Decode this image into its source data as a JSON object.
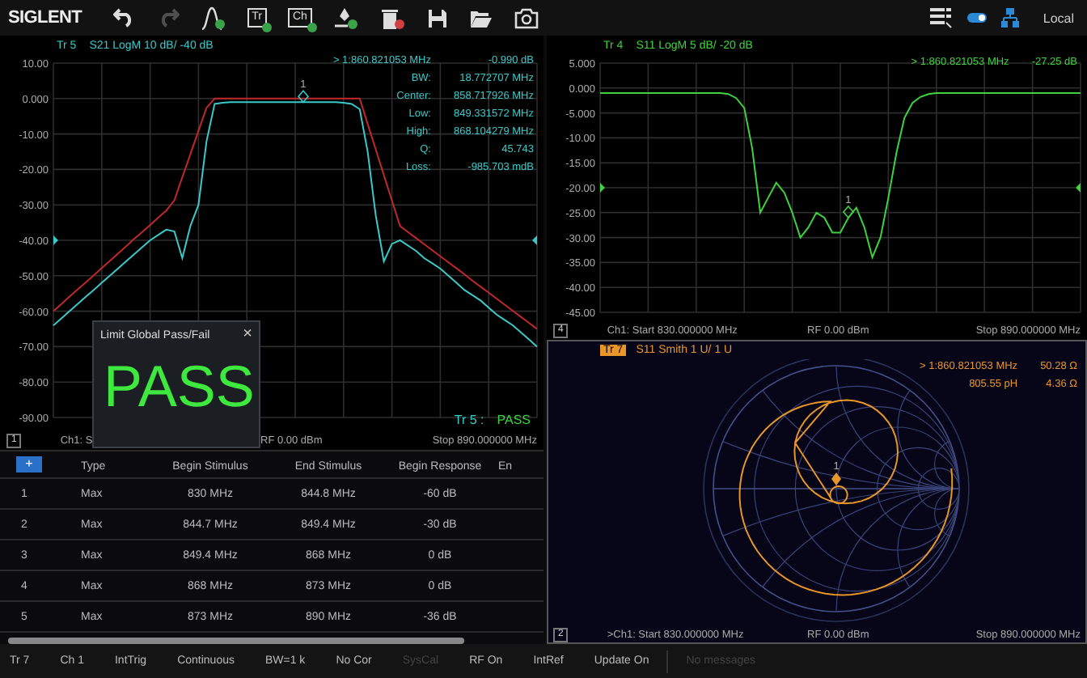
{
  "toolbar": {
    "logo": "SIGLENT",
    "tools": [
      {
        "kind": "undo",
        "disabled": false
      },
      {
        "kind": "redo",
        "disabled": true
      },
      {
        "kind": "filter",
        "disabled": false
      },
      {
        "kind": "trace",
        "label": "Tr",
        "disabled": false
      },
      {
        "kind": "channel",
        "label": "Ch",
        "disabled": false
      },
      {
        "kind": "marker",
        "disabled": false
      },
      {
        "kind": "delete",
        "disabled": false
      },
      {
        "kind": "save",
        "disabled": false
      },
      {
        "kind": "open",
        "disabled": false
      },
      {
        "kind": "camera",
        "disabled": false
      }
    ],
    "status_icons": [
      {
        "kind": "list"
      },
      {
        "kind": "toggle"
      },
      {
        "kind": "network"
      }
    ],
    "mode": "Local"
  },
  "panels": [
    {
      "kind": "logmag",
      "number": "1",
      "trace": "Tr 5",
      "selected": false,
      "header": "S21 LogM 10 dB/ -40 dB",
      "color": "#3cc8c8",
      "marker_label": "1",
      "readouts": [
        {
          "label": "> 1:860.821053 MHz",
          "value": "-0.990 dB"
        },
        {
          "label": "BW:",
          "value": "18.772707 MHz"
        },
        {
          "label": "Center:",
          "value": "858.717926 MHz"
        },
        {
          "label": "Low:",
          "value": "849.331572 MHz"
        },
        {
          "label": "High:",
          "value": "868.104279 MHz"
        },
        {
          "label": "Q:",
          "value": "45.743"
        },
        {
          "label": "Loss:",
          "value": "-985.703 mdB"
        }
      ],
      "limit_result": {
        "trace": "Tr 5 :",
        "result": "PASS"
      },
      "footer": {
        "start": "Ch1: S",
        "rf": "RF 0.00 dBm",
        "stop": "Stop 890.000000 MHz"
      },
      "chart_data": {
        "type": "line",
        "ylim": [
          -90,
          10
        ],
        "grid": true,
        "categories": [
          null,
          null,
          null,
          null,
          null,
          null,
          null,
          null,
          null,
          null,
          null,
          null,
          null,
          null,
          null,
          null,
          null,
          null,
          null,
          null,
          null,
          null,
          null,
          null,
          null,
          null,
          null,
          null,
          null,
          null,
          null,
          null,
          null,
          null,
          null,
          null,
          null,
          null,
          null,
          null,
          null,
          null,
          null,
          null,
          null,
          null,
          null,
          null,
          null,
          null,
          null,
          null,
          null,
          null,
          null,
          null,
          null,
          null,
          null,
          null,
          null
        ],
        "yticks": [
          {
            "value": 10,
            "label": "10.00"
          },
          {
            "value": 0,
            "label": "0.000"
          },
          {
            "value": -10,
            "label": "-10.00"
          },
          {
            "value": -20,
            "label": "-20.00"
          },
          {
            "value": -30,
            "label": "-30.00"
          },
          {
            "value": -40,
            "label": "-40.00"
          },
          {
            "value": -50,
            "label": "-50.00"
          },
          {
            "value": -60,
            "label": "-60.00"
          },
          {
            "value": -70,
            "label": "-70.00"
          },
          {
            "value": -80,
            "label": "-80.00"
          },
          {
            "value": -90,
            "label": "-90.00"
          }
        ],
        "series": [
          {
            "color": "#c0282c",
            "values": [
              -60,
              -58,
              -55.9,
              -53.9,
              -51.9,
              -49.9,
              -47.8,
              -45.8,
              -43.8,
              -41.8,
              -39.7,
              -37.7,
              -35.7,
              -33.6,
              -31.6,
              -28.7,
              -22.2,
              -15.7,
              -9.1,
              -2.6,
              0,
              0,
              0,
              0,
              0,
              0,
              0,
              0,
              0,
              0,
              0,
              0,
              0,
              0,
              0,
              0,
              0,
              0,
              0,
              -7.2,
              -14.4,
              -21.6,
              -28.8,
              -36,
              -37.7,
              -39.4,
              -41.1,
              -42.8,
              -44.5,
              -46.2,
              -47.9,
              -49.6,
              -51.4,
              -53.1,
              -54.8,
              -56.5,
              -58.2,
              -59.9,
              -61.6,
              -63.3,
              -65
            ]
          },
          {
            "color": "#3cc8c8",
            "values": [
              -64,
              -62,
              -60,
              -58,
              -56,
              -54,
              -52,
              -50,
              -48,
              -46,
              -44,
              -42,
              -40,
              -38.5,
              -37,
              -37.5,
              -45,
              -36,
              -30,
              -12,
              -1.5,
              -1.2,
              -1,
              -1,
              -1,
              -1,
              -1,
              -1,
              -1,
              -1,
              -1,
              -1,
              -1,
              -1,
              -1,
              -1,
              -1.2,
              -1.5,
              -3,
              -15,
              -33,
              -46,
              -41,
              -40,
              -41.5,
              -43,
              -45,
              -46.5,
              -48,
              -50,
              -52,
              -54,
              -55.5,
              -57,
              -59,
              -61,
              -62.5,
              -64,
              -66,
              -68,
              -70
            ]
          }
        ]
      }
    },
    {
      "kind": "logmag",
      "number": "4",
      "trace": "Tr 4",
      "selected": false,
      "header": "S11 LogM 5 dB/ -20 dB",
      "color": "#3ed23e",
      "marker_label": "1",
      "readouts": [
        {
          "label": "> 1:860.821053 MHz",
          "value": "-27.25 dB"
        }
      ],
      "footer": {
        "start": "Ch1: Start 830.000000 MHz",
        "rf": "RF 0.00 dBm",
        "stop": "Stop 890.000000 MHz"
      },
      "chart_data": {
        "type": "line",
        "ylim": [
          -45,
          5
        ],
        "grid": true,
        "categories": [
          null,
          null,
          null,
          null,
          null,
          null,
          null,
          null,
          null,
          null,
          null,
          null,
          null,
          null,
          null,
          null,
          null,
          null,
          null,
          null,
          null,
          null,
          null,
          null,
          null,
          null,
          null,
          null,
          null,
          null,
          null,
          null,
          null,
          null,
          null,
          null,
          null,
          null,
          null,
          null,
          null,
          null,
          null,
          null,
          null,
          null,
          null,
          null,
          null,
          null,
          null,
          null,
          null,
          null,
          null,
          null,
          null,
          null,
          null,
          null,
          null
        ],
        "yticks": [
          {
            "value": 5,
            "label": "5.000"
          },
          {
            "value": 0,
            "label": "0.000"
          },
          {
            "value": -5,
            "label": "-5.000"
          },
          {
            "value": -10,
            "label": "-10.00"
          },
          {
            "value": -15,
            "label": "-15.00"
          },
          {
            "value": -20,
            "label": "-20.00"
          },
          {
            "value": -25,
            "label": "-25.00"
          },
          {
            "value": -30,
            "label": "-30.00"
          },
          {
            "value": -35,
            "label": "-35.00"
          },
          {
            "value": -40,
            "label": "-40.00"
          },
          {
            "value": -45,
            "label": "-45.00"
          }
        ],
        "series": [
          {
            "color": "#3ed23e",
            "values": [
              -1,
              -1,
              -1,
              -1,
              -1,
              -1,
              -1,
              -1,
              -1,
              -1,
              -1,
              -1,
              -1,
              -1,
              -1,
              -1,
              -1.2,
              -2,
              -4,
              -12,
              -25,
              -22,
              -19,
              -21,
              -25,
              -30,
              -28,
              -25,
              -26,
              -29,
              -29,
              -26,
              -24,
              -28,
              -34,
              -30,
              -22,
              -13,
              -6,
              -3,
              -1.8,
              -1.2,
              -1,
              -1,
              -1,
              -1,
              -1,
              -1,
              -1,
              -1,
              -1,
              -1,
              -1,
              -1,
              -1,
              -1,
              -1,
              -1,
              -1,
              -1,
              -1
            ]
          }
        ]
      }
    },
    {
      "kind": "smith",
      "number": "2",
      "trace": "Tr 7",
      "selected": true,
      "header": "S11 Smith 1 U/ 1 U",
      "color": "#e8962a",
      "marker_label": "1",
      "readouts": [
        {
          "label": "> 1:860.821053 MHz",
          "value": "50.28 Ω"
        },
        {
          "label": "805.55 pH",
          "value": "4.36 Ω"
        }
      ],
      "footer": {
        "start": ">Ch1: Start 830.000000 MHz",
        "rf": "RF 0.00 dBm",
        "stop": "Stop 890.000000 MHz"
      }
    }
  ],
  "popup": {
    "title": "Limit Global Pass/Fail",
    "close": "×",
    "result": "PASS"
  },
  "limit_table": {
    "add_button": "+",
    "columns": [
      "Type",
      "Begin Stimulus",
      "End Stimulus",
      "Begin Response",
      "En"
    ],
    "rows": [
      {
        "number": "1",
        "cells": [
          "Max",
          "830 MHz",
          "844.8 MHz",
          "-60 dB"
        ]
      },
      {
        "number": "2",
        "cells": [
          "Max",
          "844.7 MHz",
          "849.4 MHz",
          "-30 dB"
        ]
      },
      {
        "number": "3",
        "cells": [
          "Max",
          "849.4 MHz",
          "868 MHz",
          "0 dB"
        ]
      },
      {
        "number": "4",
        "cells": [
          "Max",
          "868 MHz",
          "873 MHz",
          "0 dB"
        ]
      },
      {
        "number": "5",
        "cells": [
          "Max",
          "873 MHz",
          "890 MHz",
          "-36 dB"
        ]
      }
    ]
  },
  "status_bar": {
    "items": [
      {
        "label": "Tr 7",
        "disabled": false
      },
      {
        "label": "Ch 1",
        "disabled": false
      },
      {
        "label": "IntTrig",
        "disabled": false
      },
      {
        "label": "Continuous",
        "disabled": false
      },
      {
        "label": "BW=1 k",
        "disabled": false
      },
      {
        "label": "No Cor",
        "disabled": false
      },
      {
        "label": "SysCal",
        "disabled": true
      },
      {
        "label": "RF On",
        "disabled": false
      },
      {
        "label": "IntRef",
        "disabled": false
      },
      {
        "label": "Update On",
        "disabled": false
      }
    ],
    "message": "No messages"
  }
}
